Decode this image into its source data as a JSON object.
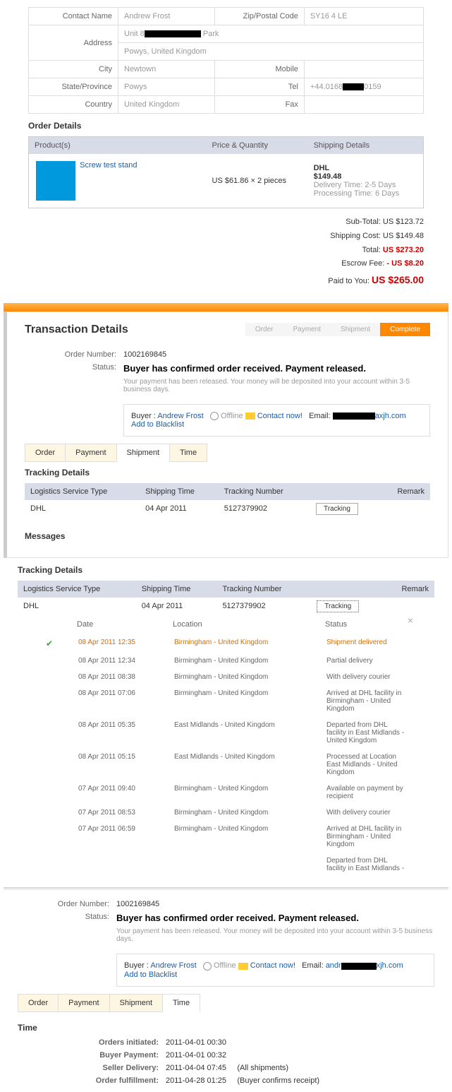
{
  "contact": {
    "name_label": "Contact Name",
    "name": "Andrew Frost",
    "zip_label": "Zip/Postal Code",
    "zip": "SY16 4 LE",
    "addr_label": "Address",
    "addr1_pre": "Unit 8",
    "addr1_post": " Park",
    "addr2": "Powys, United Kingdom",
    "city_label": "City",
    "city": "Newtown",
    "mobile_label": "Mobile",
    "mobile": "",
    "state_label": "State/Province",
    "state": "Powys",
    "tel_label": "Tel",
    "tel_pre": "+44.0168",
    "tel_post": "0159",
    "country_label": "Country",
    "country": "United Kingdom",
    "fax_label": "Fax",
    "fax": ""
  },
  "order_details": {
    "title": "Order Details",
    "cols": {
      "p": "Product(s)",
      "pq": "Price & Quantity",
      "sd": "Shipping Details"
    },
    "product": "Screw test stand",
    "price": "US $61.86 × 2 pieces",
    "ship_carrier": "DHL",
    "ship_cost": "$149.48",
    "ship_dt_l": "Delivery Time:",
    "ship_dt": "2-5 Days",
    "ship_pt_l": "Processing Time:",
    "ship_pt": "6 Days"
  },
  "totals": {
    "sub_l": "Sub-Total:",
    "sub": "US $123.72",
    "ship_l": "Shipping Cost:",
    "ship": "US $149.48",
    "tot_l": "Total:",
    "tot": "US $273.20",
    "esc_l": "Escrow Fee:",
    "esc": "- US $8.20",
    "paid_l": "Paid to You:",
    "paid": "US $265.00"
  },
  "trans": {
    "title": "Transaction Details",
    "steps": {
      "a": "Order",
      "b": "Payment",
      "c": "Shipment",
      "d": "Complete"
    },
    "ordnum_l": "Order Number:",
    "ordnum": "1002169845",
    "status_l": "Status:",
    "status": "Buyer has confirmed order received. Payment released.",
    "note": "Your payment has been released. Your money will be deposited into your account within 3-5 business days.",
    "buyer_l": "Buyer :",
    "buyer": "Andrew Frost",
    "offline": "Offline",
    "contact": "Contact now!",
    "email_l": "Email:",
    "email_post": "axjh.com",
    "blacklist": "Add to Blacklist",
    "tabs": {
      "o": "Order",
      "p": "Payment",
      "s": "Shipment",
      "t": "Time"
    }
  },
  "tracking": {
    "title": "Tracking Details",
    "cols": {
      "lst": "Logistics Service Type",
      "st": "Shipping Time",
      "tn": "Tracking Number",
      "rm": "Remark"
    },
    "carrier": "DHL",
    "date": "04 Apr 2011",
    "num": "5127379902",
    "btn": "Tracking"
  },
  "messages": "Messages",
  "evt_cols": {
    "d": "Date",
    "l": "Location",
    "s": "Status"
  },
  "events": [
    {
      "d": "08 Apr 2011 12:35",
      "l": "Birmingham - United Kingdom",
      "s": "Shipment delivered",
      "hl": true,
      "check": true
    },
    {
      "d": "08 Apr 2011 12:34",
      "l": "Birmingham - United Kingdom",
      "s": "Partial delivery"
    },
    {
      "d": "08 Apr 2011 08:38",
      "l": "Birmingham - United Kingdom",
      "s": "With delivery courier"
    },
    {
      "d": "08 Apr 2011 07:06",
      "l": "Birmingham - United Kingdom",
      "s": "Arrived at DHL facility in Birmingham - United Kingdom"
    },
    {
      "d": "08 Apr 2011 05:35",
      "l": "East Midlands - United Kingdom",
      "s": "Departed from DHL facility in East Midlands - United Kingdom"
    },
    {
      "d": "08 Apr 2011 05:15",
      "l": "East Midlands - United Kingdom",
      "s": "Processed at Location East Midlands - United Kingdom"
    },
    {
      "d": "07 Apr 2011 09:40",
      "l": "Birmingham - United Kingdom",
      "s": "Available on payment by recipient"
    },
    {
      "d": "07 Apr 2011 08:53",
      "l": "Birmingham - United Kingdom",
      "s": "With delivery courier"
    },
    {
      "d": "07 Apr 2011 06:59",
      "l": "Birmingham - United Kingdom",
      "s": "Arrived at DHL facility in Birmingham - United Kingdom"
    },
    {
      "d": "",
      "l": "",
      "s": "Departed from DHL facility in East Midlands -"
    }
  ],
  "buyer2": {
    "email_pre": "andr",
    "email_post": "xjh.com"
  },
  "time": {
    "title": "Time",
    "r1_l": "Orders initiated:",
    "r1": "2011-04-01 00:30",
    "r2_l": "Buyer Payment:",
    "r2": "2011-04-01 00:32",
    "r3_l": "Seller Delivery:",
    "r3": "2011-04-04 07:45",
    "r3n": "(All shipments)",
    "r4_l": "Order fulfillment:",
    "r4": "2011-04-28 01:25",
    "r4n": "(Buyer confirms receipt)"
  }
}
